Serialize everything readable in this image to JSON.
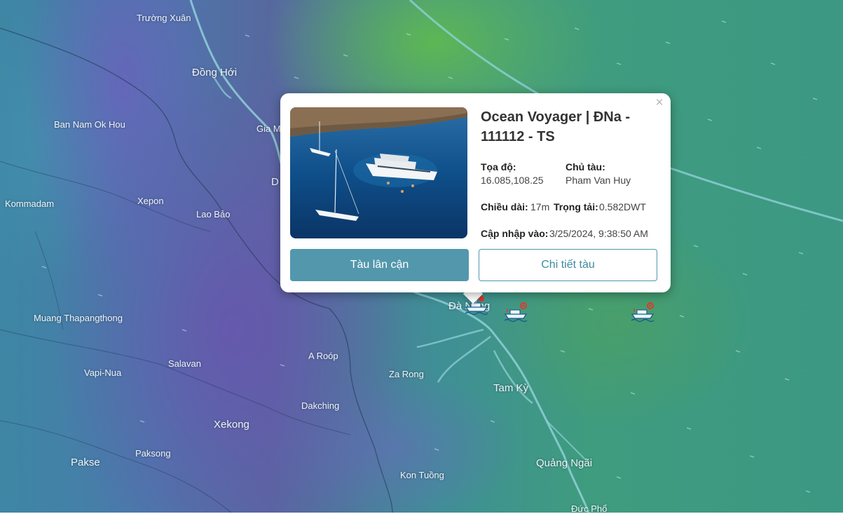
{
  "map": {
    "places": [
      {
        "id": "truong-xuan",
        "name": "Trường Xuân"
      },
      {
        "id": "dong-hoi",
        "name": "Đồng Hới"
      },
      {
        "id": "ban-nam-ok-hou",
        "name": "Ban Nam Ok Hou"
      },
      {
        "id": "gia-m",
        "name": "Gia M"
      },
      {
        "id": "d-partial",
        "name": "D"
      },
      {
        "id": "kommadam",
        "name": "Kommadam"
      },
      {
        "id": "xepon",
        "name": "Xepon"
      },
      {
        "id": "lao-bao",
        "name": "Lao Bảo"
      },
      {
        "id": "muang-thapangthong",
        "name": "Muang Thapangthong"
      },
      {
        "id": "da-nang",
        "name": "Đà Nẵng"
      },
      {
        "id": "a-roop",
        "name": "A Roóp"
      },
      {
        "id": "vapi-nua",
        "name": "Vapi-Nua"
      },
      {
        "id": "salavan",
        "name": "Salavan"
      },
      {
        "id": "za-rong",
        "name": "Za Rong"
      },
      {
        "id": "tam-ky",
        "name": "Tam Kỳ"
      },
      {
        "id": "dakching",
        "name": "Dakching"
      },
      {
        "id": "xekong",
        "name": "Xekong"
      },
      {
        "id": "paksong",
        "name": "Paksong"
      },
      {
        "id": "pakse",
        "name": "Pakse"
      },
      {
        "id": "quang-ngai",
        "name": "Quảng Ngãi"
      },
      {
        "id": "kon-tuong",
        "name": "Kon Tuồng"
      },
      {
        "id": "duc-pho",
        "name": "Đức Phổ"
      }
    ],
    "ship_markers": [
      {
        "id": "ship-da-nang",
        "status_color": "#e03a2a"
      },
      {
        "id": "ship-offshore-1",
        "status_color": "#e03a2a"
      },
      {
        "id": "ship-offshore-2",
        "status_color": "#e03a2a"
      }
    ]
  },
  "popup": {
    "close_label": "×",
    "photo_alt": "Ocean Voyager",
    "title": "Ocean Voyager | ĐNa - 111112 - TS",
    "coords_label": "Tọa độ:",
    "coords_value": "16.085,108.25",
    "owner_label": "Chủ tàu:",
    "owner_value": "Pham Van Huy",
    "length_label": "Chiều dài:",
    "length_value": "17m",
    "tonnage_label": "Trọng tải:",
    "tonnage_value": "0.582DWT",
    "updated_label": "Cập nhập vào:",
    "updated_value": "3/25/2024, 9:38:50 AM",
    "nearby_button": "Tàu lân cận",
    "detail_button": "Chi tiết tàu"
  },
  "colors": {
    "accent": "#5397ad",
    "marker_alert": "#e03a2a"
  }
}
